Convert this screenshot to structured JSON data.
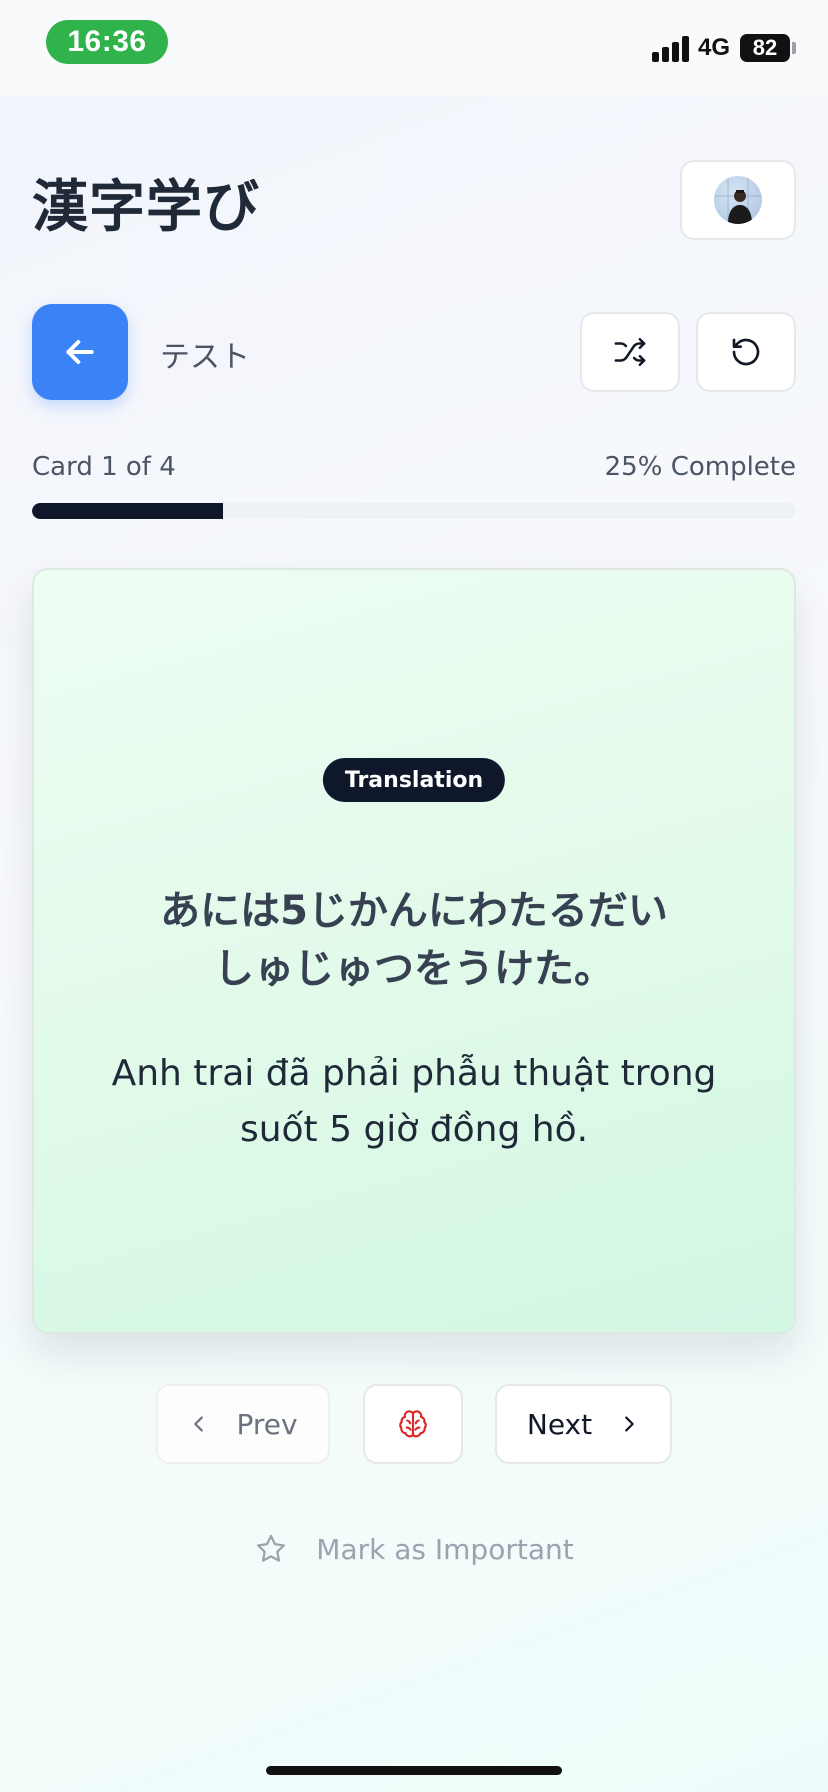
{
  "status_bar": {
    "time": "16:36",
    "network": "4G",
    "battery": "82",
    "icons": [
      "signal-icon",
      "battery-icon"
    ]
  },
  "header": {
    "app_title": "漢字学び",
    "avatar_icon": "user-avatar"
  },
  "toolbar": {
    "back_icon": "arrow-left-icon",
    "deck_label": "テスト",
    "shuffle_icon": "shuffle-icon",
    "reset_icon": "rotate-ccw-icon"
  },
  "progress": {
    "card_counter": "Card 1 of 4",
    "complete_label": "25% Complete",
    "percent": 25
  },
  "card": {
    "badge": "Translation",
    "japanese_line1": "あには5じかんにわたるだい",
    "japanese_line2": "しゅじゅつをうけた。",
    "vietnamese_line1": "Anh trai đã phải phẫu thuật trong",
    "vietnamese_line2": "suốt 5 giờ đồng hồ."
  },
  "navigation": {
    "prev_label": "Prev",
    "next_label": "Next",
    "brain_icon": "brain-icon"
  },
  "mark": {
    "label": "Mark as Important",
    "icon": "star-icon"
  },
  "colors": {
    "accent": "#3b82f6",
    "progress": "#0f172a",
    "time_pill": "#2fb34a",
    "brain": "#dc2626"
  }
}
